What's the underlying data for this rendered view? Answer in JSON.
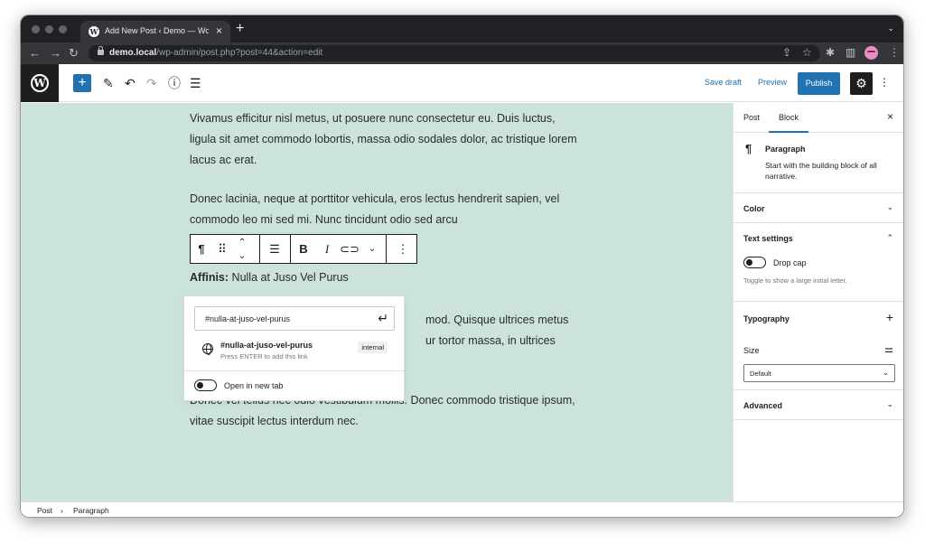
{
  "browser": {
    "tab_title": "Add New Post ‹ Demo — WordPress",
    "url_host": "demo.local",
    "url_path": "/wp-admin/post.php?post=44&action=edit"
  },
  "header": {
    "save_draft": "Save draft",
    "preview": "Preview",
    "publish": "Publish"
  },
  "content": {
    "para1": "Vivamus efficitur nisl metus, ut posuere nunc consectetur eu. Duis luctus, ligula sit amet commodo lobortis, massa odio sodales dolor, ac tristique lorem lacus ac erat.",
    "para2": "Donec lacinia, neque at porttitor vehicula, eros lectus hendrerit sapien, vel commodo leo mi sed mi. Nunc tincidunt odio sed arcu",
    "affinis_bold": "Affinis:",
    "affinis_rest": " Nulla at Juso Vel Purus",
    "para3_line1_tail": "mod. Quisque ultrices metus",
    "para3_line2_tail": "ur tortor massa, in ultrices",
    "para4": "Donec vel tellus nec odio vestibulum mollis. Donec commodo tristique ipsum, vitae suscipit lectus interdum nec."
  },
  "link_popover": {
    "input_value": "#nulla-at-juso-vel-purus",
    "suggestion_title": "#nulla-at-juso-vel-purus",
    "suggestion_desc": "Press ENTER to add this link",
    "suggestion_type": "internal",
    "new_tab_label": "Open in new tab"
  },
  "sidebar": {
    "tab_post": "Post",
    "tab_block": "Block",
    "block_name": "Paragraph",
    "block_desc": "Start with the building block of all narrative.",
    "panel_color": "Color",
    "panel_text_settings": "Text settings",
    "drop_cap_label": "Drop cap",
    "drop_cap_help": "Toggle to show a large initial letter.",
    "panel_typography": "Typography",
    "size_label": "Size",
    "size_value": "Default",
    "panel_advanced": "Advanced"
  },
  "footer": {
    "crumb_post": "Post",
    "crumb_paragraph": "Paragraph"
  },
  "colors": {
    "canvas_bg": "#cce3dc",
    "accent": "#2271b1",
    "dark": "#1e1e1e"
  }
}
